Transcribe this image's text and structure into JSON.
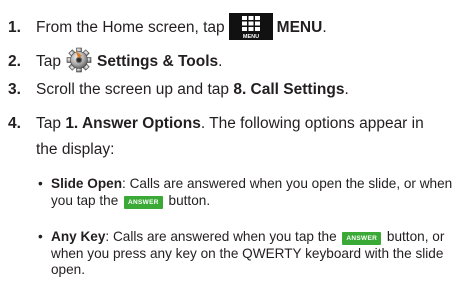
{
  "steps": [
    {
      "num": "1.",
      "text_before": "From the Home screen, tap",
      "bold": "MENU",
      "text_after": ".",
      "icon": "menu-grid-icon",
      "icon_label": "MENU"
    },
    {
      "num": "2.",
      "text_before": "Tap",
      "bold": "Settings & Tools",
      "text_after": ".",
      "icon": "settings-gear-icon"
    },
    {
      "num": "3.",
      "text_before": "Scroll the screen up and tap ",
      "bold": "8. Call Settings",
      "text_after": "."
    },
    {
      "num": "4.",
      "text_before": "Tap ",
      "bold": "1. Answer Options",
      "text_after": ". The following options appear in",
      "continuation": "the display:"
    }
  ],
  "options": [
    {
      "title": "Slide Open",
      "line1": ": Calls are answered when you open the slide, or when",
      "line2_before": "you tap the",
      "line2_after": "button."
    },
    {
      "title": "Any Key",
      "line1_before": ": Calls are answered when you tap the",
      "line1_after": "button, or",
      "line2": "when you press any key on the QWERTY keyboard with the slide",
      "line3": "open."
    }
  ],
  "answer_button_label": "ANSWER",
  "colors": {
    "text": "#231f20",
    "answer_button": "#3aa935",
    "menu_icon_bg": "#111111"
  }
}
